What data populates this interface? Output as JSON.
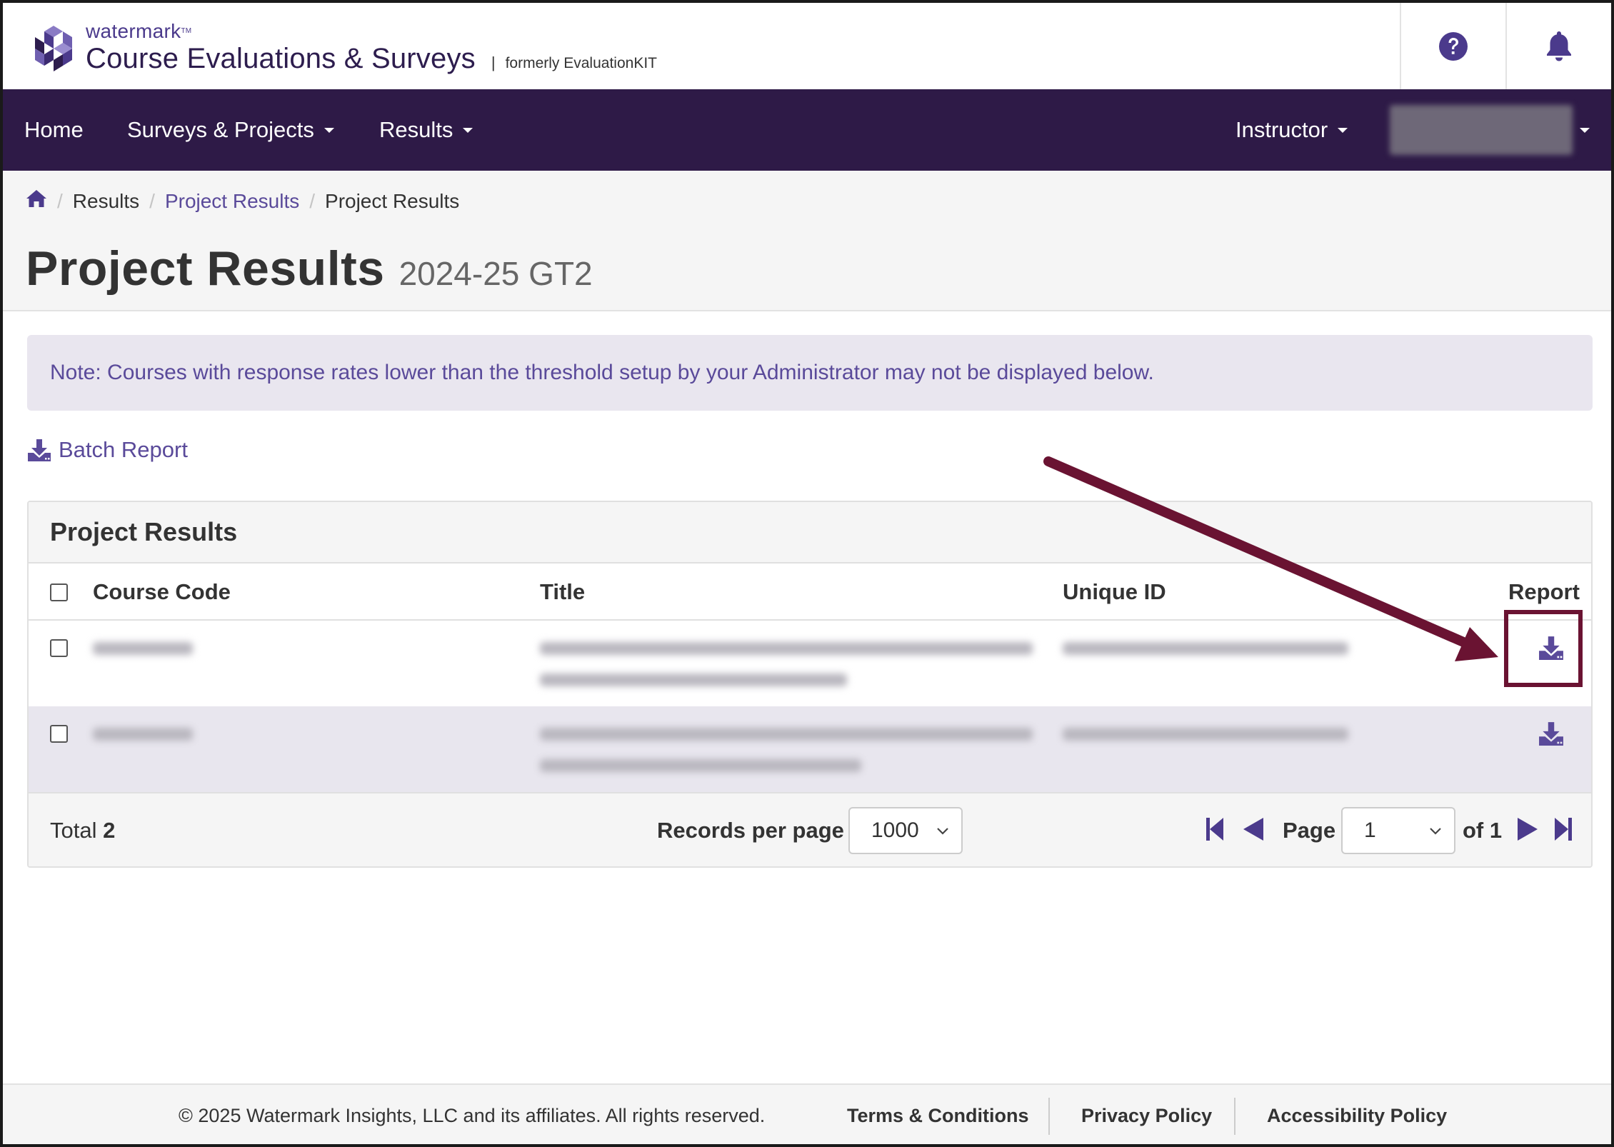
{
  "header": {
    "brand_small": "watermark",
    "brand_tm": "TM",
    "brand_title": "Course Evaluations & Surveys",
    "brand_sep": "|",
    "brand_formerly": "formerly EvaluationKIT"
  },
  "nav": {
    "home": "Home",
    "surveys": "Surveys & Projects",
    "results": "Results",
    "role": "Instructor"
  },
  "breadcrumb": {
    "sep": "/",
    "results": "Results",
    "project_results_link": "Project Results",
    "current": "Project Results"
  },
  "page": {
    "title": "Project Results",
    "subtitle": "2024-25 GT2"
  },
  "note": "Note: Courses with response rates lower than the threshold setup by your Administrator may not be displayed below.",
  "batch_report": "Batch Report",
  "panel": {
    "title": "Project Results",
    "columns": [
      "Course Code",
      "Title",
      "Unique ID",
      "Report"
    ],
    "total_label": "Total",
    "total_value": "2",
    "records_label": "Records per page",
    "records_value": "1000",
    "page_label": "Page",
    "page_value": "1",
    "of_label": "of 1"
  },
  "footer": {
    "copyright": "© 2025 Watermark Insights, LLC and its affiliates. All rights reserved.",
    "terms": "Terms & Conditions",
    "privacy": "Privacy Policy",
    "accessibility": "Accessibility Policy"
  },
  "colors": {
    "brand_purple": "#2e1a47",
    "link_purple": "#5a4a9a",
    "annotation": "#6a1332"
  },
  "icons": [
    "help-icon",
    "bell-icon",
    "home-icon",
    "download-icon",
    "first-page-icon",
    "prev-page-icon",
    "next-page-icon",
    "last-page-icon"
  ]
}
